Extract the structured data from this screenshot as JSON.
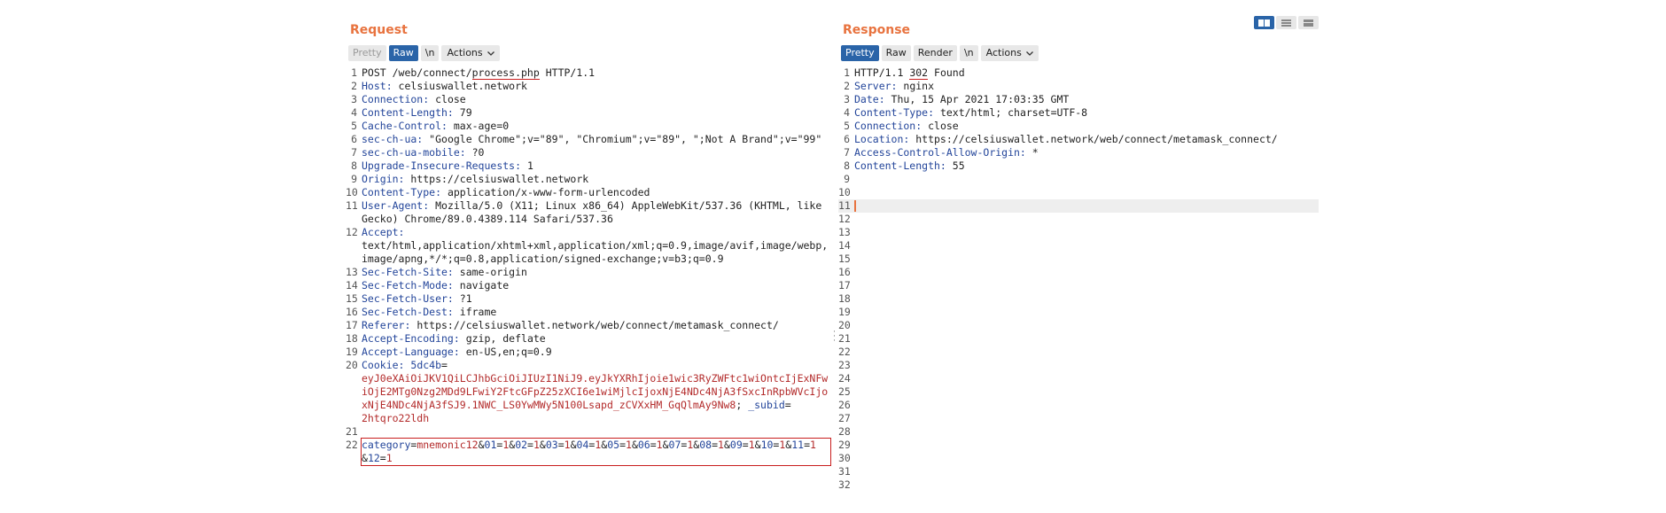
{
  "request": {
    "title": "Request",
    "tabs": [
      "Pretty",
      "Raw",
      "\\n"
    ],
    "actions_label": "Actions",
    "lines": [
      {
        "n": "1",
        "parts": [
          {
            "t": "POST /web/connect/",
            "c": ""
          },
          {
            "t": "process.php",
            "c": "ul"
          },
          {
            "t": " HTTP/1.1",
            "c": ""
          }
        ]
      },
      {
        "n": "2",
        "parts": [
          {
            "t": "Host:",
            "c": "hname"
          },
          {
            "t": " celsiuswallet.network",
            "c": ""
          }
        ]
      },
      {
        "n": "3",
        "parts": [
          {
            "t": "Connection:",
            "c": "hname"
          },
          {
            "t": " close",
            "c": ""
          }
        ]
      },
      {
        "n": "4",
        "parts": [
          {
            "t": "Content-Length:",
            "c": "hname"
          },
          {
            "t": " 79",
            "c": ""
          }
        ]
      },
      {
        "n": "5",
        "parts": [
          {
            "t": "Cache-Control:",
            "c": "hname"
          },
          {
            "t": " max-age=0",
            "c": ""
          }
        ]
      },
      {
        "n": "6",
        "parts": [
          {
            "t": "sec-ch-ua:",
            "c": "hname"
          },
          {
            "t": " \"Google Chrome\";v=\"89\", \"Chromium\";v=\"89\", \";Not A Brand\";v=\"99\"",
            "c": ""
          }
        ]
      },
      {
        "n": "7",
        "parts": [
          {
            "t": "sec-ch-ua-mobile:",
            "c": "hname"
          },
          {
            "t": " ?0",
            "c": ""
          }
        ]
      },
      {
        "n": "8",
        "parts": [
          {
            "t": "Upgrade-Insecure-Requests:",
            "c": "hname"
          },
          {
            "t": " 1",
            "c": ""
          }
        ]
      },
      {
        "n": "9",
        "parts": [
          {
            "t": "Origin:",
            "c": "hname"
          },
          {
            "t": " https://celsiuswallet.network",
            "c": ""
          }
        ]
      },
      {
        "n": "10",
        "parts": [
          {
            "t": "Content-Type:",
            "c": "hname"
          },
          {
            "t": " application/x-www-form-urlencoded",
            "c": ""
          }
        ]
      },
      {
        "n": "11",
        "parts": [
          {
            "t": "User-Agent:",
            "c": "hname"
          },
          {
            "t": " Mozilla/5.0 (X11; Linux x86_64) AppleWebKit/537.36 (KHTML, like Gecko) Chrome/89.0.4389.114 Safari/537.36",
            "c": ""
          }
        ]
      },
      {
        "n": "12",
        "parts": [
          {
            "t": "Accept:",
            "c": "hname"
          },
          {
            "t": "\ntext/html,application/xhtml+xml,application/xml;q=0.9,image/avif,image/webp,image/apng,*/*;q=0.8,application/signed-exchange;v=b3;q=0.9",
            "c": ""
          }
        ]
      },
      {
        "n": "13",
        "parts": [
          {
            "t": "Sec-Fetch-Site:",
            "c": "hname"
          },
          {
            "t": " same-origin",
            "c": ""
          }
        ]
      },
      {
        "n": "14",
        "parts": [
          {
            "t": "Sec-Fetch-Mode:",
            "c": "hname"
          },
          {
            "t": " navigate",
            "c": ""
          }
        ]
      },
      {
        "n": "15",
        "parts": [
          {
            "t": "Sec-Fetch-User:",
            "c": "hname"
          },
          {
            "t": " ?1",
            "c": ""
          }
        ]
      },
      {
        "n": "16",
        "parts": [
          {
            "t": "Sec-Fetch-Dest:",
            "c": "hname"
          },
          {
            "t": " iframe",
            "c": ""
          }
        ]
      },
      {
        "n": "17",
        "parts": [
          {
            "t": "Referer:",
            "c": "hname"
          },
          {
            "t": " https://celsiuswallet.network/web/connect/metamask_connect/",
            "c": ""
          }
        ]
      },
      {
        "n": "18",
        "parts": [
          {
            "t": "Accept-Encoding:",
            "c": "hname"
          },
          {
            "t": " gzip, deflate",
            "c": ""
          }
        ]
      },
      {
        "n": "19",
        "parts": [
          {
            "t": "Accept-Language:",
            "c": "hname"
          },
          {
            "t": " en-US,en;q=0.9",
            "c": ""
          }
        ]
      },
      {
        "n": "20",
        "parts": [
          {
            "t": "Cookie:",
            "c": "hname"
          },
          {
            "t": " ",
            "c": ""
          },
          {
            "t": "5dc4b",
            "c": "hname"
          },
          {
            "t": "=",
            "c": ""
          },
          {
            "t": "\neyJ0eXAiOiJKV1QiLCJhbGciOiJIUzI1NiJ9.eyJkYXRhIjoie1wic3RyZWFtc1wiOntcIjExNFwiOjE2MTg0Nzg2MDd9LFwiY2FtcGFpZ25zXCI6e1wiMjlcIjoxNjE4NDc4NjA3fSxcInRpbWVcIjoxNjE4NDc4NjA3fSJ9.1NWC_LS0YwMWy5N100Lsapd_zCVXxHM_GqQlmAy9Nw8",
            "c": "cookieval"
          },
          {
            "t": "; ",
            "c": ""
          },
          {
            "t": "_subid",
            "c": "hname"
          },
          {
            "t": "=",
            "c": ""
          },
          {
            "t": "\n2htqro22ldh",
            "c": "cookieval"
          }
        ]
      },
      {
        "n": "21",
        "parts": [
          {
            "t": "",
            "c": ""
          }
        ]
      },
      {
        "n": "22",
        "boxed": true,
        "parts": [
          {
            "t": "category",
            "c": "pname"
          },
          {
            "t": "=",
            "c": ""
          },
          {
            "t": "mnemonic12",
            "c": "pval"
          },
          {
            "t": "&",
            "c": ""
          },
          {
            "t": "01",
            "c": "pname"
          },
          {
            "t": "=",
            "c": ""
          },
          {
            "t": "1",
            "c": "pval"
          },
          {
            "t": "&",
            "c": ""
          },
          {
            "t": "02",
            "c": "pname"
          },
          {
            "t": "=",
            "c": ""
          },
          {
            "t": "1",
            "c": "pval"
          },
          {
            "t": "&",
            "c": ""
          },
          {
            "t": "03",
            "c": "pname"
          },
          {
            "t": "=",
            "c": ""
          },
          {
            "t": "1",
            "c": "pval"
          },
          {
            "t": "&",
            "c": ""
          },
          {
            "t": "04",
            "c": "pname"
          },
          {
            "t": "=",
            "c": ""
          },
          {
            "t": "1",
            "c": "pval"
          },
          {
            "t": "&",
            "c": ""
          },
          {
            "t": "05",
            "c": "pname"
          },
          {
            "t": "=",
            "c": ""
          },
          {
            "t": "1",
            "c": "pval"
          },
          {
            "t": "&",
            "c": ""
          },
          {
            "t": "06",
            "c": "pname"
          },
          {
            "t": "=",
            "c": ""
          },
          {
            "t": "1",
            "c": "pval"
          },
          {
            "t": "&",
            "c": ""
          },
          {
            "t": "07",
            "c": "pname"
          },
          {
            "t": "=",
            "c": ""
          },
          {
            "t": "1",
            "c": "pval"
          },
          {
            "t": "&",
            "c": ""
          },
          {
            "t": "08",
            "c": "pname"
          },
          {
            "t": "=",
            "c": ""
          },
          {
            "t": "1",
            "c": "pval"
          },
          {
            "t": "&",
            "c": ""
          },
          {
            "t": "09",
            "c": "pname"
          },
          {
            "t": "=",
            "c": ""
          },
          {
            "t": "1",
            "c": "pval"
          },
          {
            "t": "&",
            "c": ""
          },
          {
            "t": "10",
            "c": "pname"
          },
          {
            "t": "=",
            "c": ""
          },
          {
            "t": "1",
            "c": "pval"
          },
          {
            "t": "&",
            "c": ""
          },
          {
            "t": "11",
            "c": "pname"
          },
          {
            "t": "=",
            "c": ""
          },
          {
            "t": "1",
            "c": "pval"
          },
          {
            "t": "\n&",
            "c": ""
          },
          {
            "t": "12",
            "c": "pname"
          },
          {
            "t": "=",
            "c": ""
          },
          {
            "t": "1",
            "c": "pval"
          }
        ]
      }
    ]
  },
  "response": {
    "title": "Response",
    "tabs": [
      "Pretty",
      "Raw",
      "Render",
      "\\n"
    ],
    "actions_label": "Actions",
    "lines": [
      {
        "n": "1",
        "parts": [
          {
            "t": "HTTP/1.1 ",
            "c": ""
          },
          {
            "t": "302",
            "c": "ul"
          },
          {
            "t": " Found",
            "c": ""
          }
        ]
      },
      {
        "n": "2",
        "parts": [
          {
            "t": "Server:",
            "c": "hname"
          },
          {
            "t": " nginx",
            "c": ""
          }
        ]
      },
      {
        "n": "3",
        "parts": [
          {
            "t": "Date:",
            "c": "hname"
          },
          {
            "t": " Thu, 15 Apr 2021 17:03:35 GMT",
            "c": ""
          }
        ]
      },
      {
        "n": "4",
        "parts": [
          {
            "t": "Content-Type:",
            "c": "hname"
          },
          {
            "t": " text/html; charset=UTF-8",
            "c": ""
          }
        ]
      },
      {
        "n": "5",
        "parts": [
          {
            "t": "Connection:",
            "c": "hname"
          },
          {
            "t": " close",
            "c": ""
          }
        ]
      },
      {
        "n": "6",
        "parts": [
          {
            "t": "Location:",
            "c": "hname"
          },
          {
            "t": " https://celsiuswallet.network/web/connect/metamask_connect/",
            "c": ""
          }
        ]
      },
      {
        "n": "7",
        "parts": [
          {
            "t": "Access-Control-Allow-Origin:",
            "c": "hname"
          },
          {
            "t": " *",
            "c": ""
          }
        ]
      },
      {
        "n": "8",
        "parts": [
          {
            "t": "Content-Length:",
            "c": "hname"
          },
          {
            "t": " 55",
            "c": ""
          }
        ]
      },
      {
        "n": "9",
        "parts": []
      },
      {
        "n": "10",
        "parts": []
      },
      {
        "n": "11",
        "current": true,
        "parts": []
      },
      {
        "n": "12",
        "parts": []
      },
      {
        "n": "13",
        "parts": []
      },
      {
        "n": "14",
        "parts": []
      },
      {
        "n": "15",
        "parts": []
      },
      {
        "n": "16",
        "parts": []
      },
      {
        "n": "17",
        "parts": []
      },
      {
        "n": "18",
        "parts": []
      },
      {
        "n": "19",
        "parts": []
      },
      {
        "n": "20",
        "parts": []
      },
      {
        "n": "21",
        "parts": []
      },
      {
        "n": "22",
        "parts": []
      },
      {
        "n": "23",
        "parts": []
      },
      {
        "n": "24",
        "parts": []
      },
      {
        "n": "25",
        "parts": []
      },
      {
        "n": "26",
        "parts": []
      },
      {
        "n": "27",
        "parts": []
      },
      {
        "n": "28",
        "parts": []
      },
      {
        "n": "29",
        "parts": []
      },
      {
        "n": "30",
        "parts": []
      },
      {
        "n": "31",
        "parts": []
      },
      {
        "n": "32",
        "parts": []
      }
    ]
  },
  "colors": {
    "accent": "#e8733f",
    "active_tab": "#2a64a8",
    "header_name": "#23459a",
    "value_red": "#b32b2b",
    "highlight": "#c81e1e"
  },
  "icons": {
    "view_toggle": [
      "split-horizontal-icon",
      "split-vertical-icon",
      "tabs-icon"
    ],
    "actions": "chevron-down-icon"
  }
}
